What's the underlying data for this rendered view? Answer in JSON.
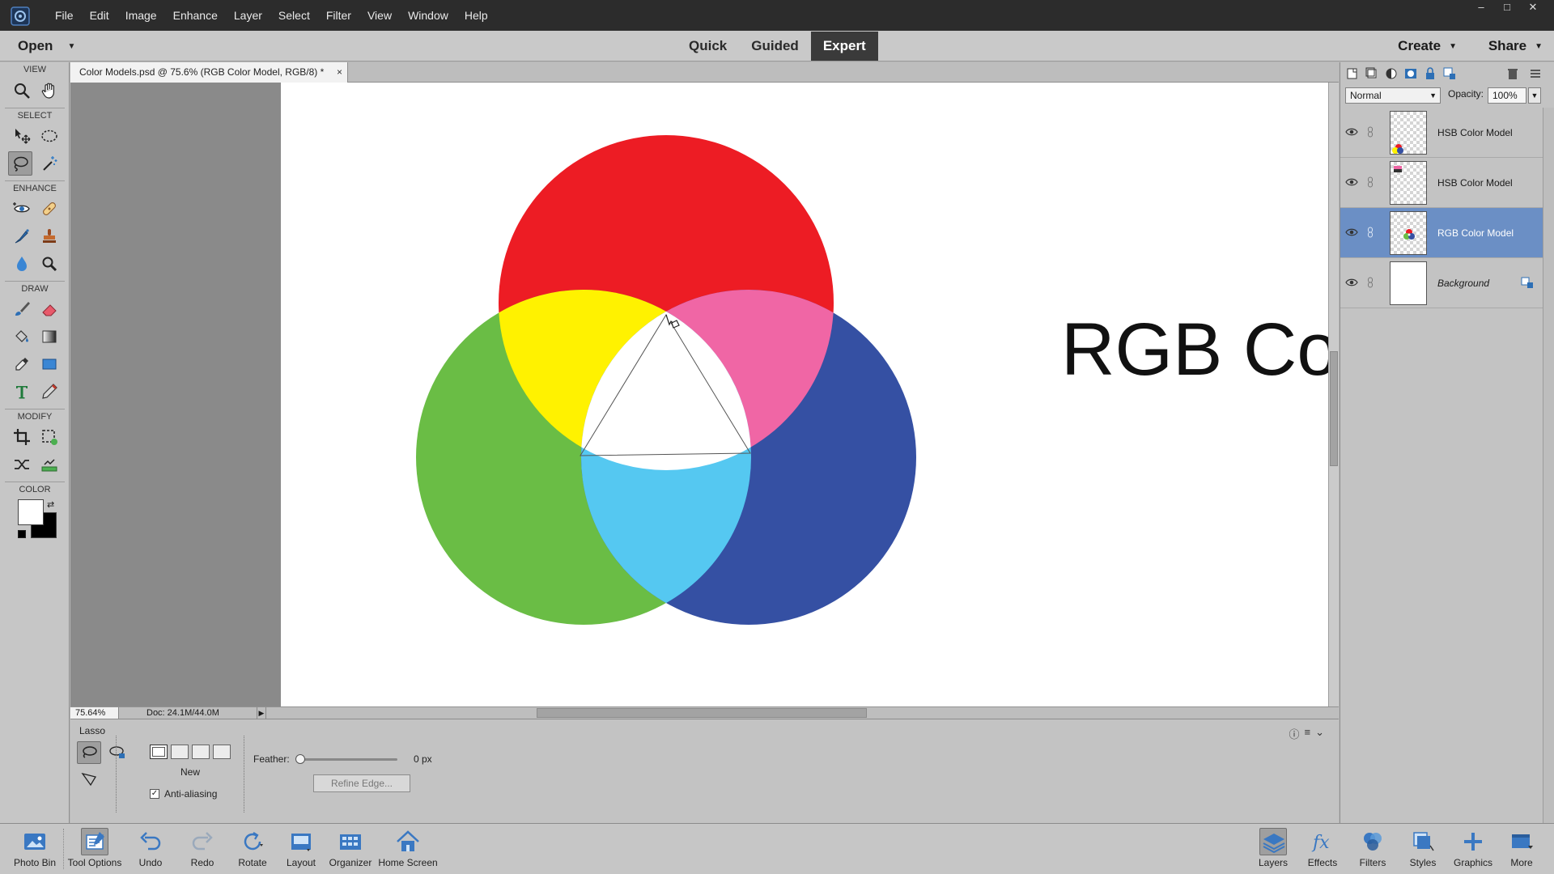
{
  "menu": {
    "items": [
      "File",
      "Edit",
      "Image",
      "Enhance",
      "Layer",
      "Select",
      "Filter",
      "View",
      "Window",
      "Help"
    ]
  },
  "window_controls": {
    "minimize": "–",
    "restore": "□",
    "close": "✕"
  },
  "modebar": {
    "open_label": "Open",
    "modes": [
      "Quick",
      "Guided",
      "Expert"
    ],
    "active_mode": "Expert",
    "create_label": "Create",
    "share_label": "Share"
  },
  "toolbox": {
    "sections": {
      "view": "VIEW",
      "select": "SELECT",
      "enhance": "ENHANCE",
      "draw": "DRAW",
      "modify": "MODIFY",
      "color": "COLOR"
    },
    "active_tool": "lasso",
    "foreground_color": "#ffffff",
    "background_color": "#000000"
  },
  "document": {
    "tab_title": "Color Models.psd @ 75.6% (RGB Color Model, RGB/8) *",
    "close_glyph": "×",
    "heading": "RGB Co",
    "colors": {
      "red": "#ed1c24",
      "green": "#6abd45",
      "blue": "#3550a3",
      "yellow": "#fff200",
      "magenta": "#f066a5",
      "cyan": "#55c8f1",
      "white": "#ffffff"
    }
  },
  "status": {
    "zoom": "75.64%",
    "doc_size": "Doc: 24.1M/44.0M",
    "arrow": "▶"
  },
  "tool_options": {
    "tool_name": "Lasso",
    "selection_mode_label": "New",
    "feather_label": "Feather:",
    "feather_value": 0,
    "feather_unit": "0 px",
    "anti_alias_label": "Anti-aliasing",
    "anti_alias_checked": true,
    "refine_edge_label": "Refine Edge..."
  },
  "layers": {
    "blend_mode": "Normal",
    "opacity_label": "Opacity:",
    "opacity_value": "100%",
    "items": [
      {
        "name": "HSB Color Model",
        "selected": false,
        "visible": true
      },
      {
        "name": "HSB Color Model",
        "selected": false,
        "visible": true
      },
      {
        "name": "RGB Color Model",
        "selected": true,
        "visible": true
      },
      {
        "name": "Background",
        "selected": false,
        "visible": true,
        "locked": true
      }
    ]
  },
  "taskbar": {
    "left": [
      {
        "label": "Photo Bin",
        "icon": "photo-bin-icon"
      },
      {
        "label": "Tool Options",
        "icon": "tool-options-icon"
      },
      {
        "label": "Undo",
        "icon": "undo-icon"
      },
      {
        "label": "Redo",
        "icon": "redo-icon"
      },
      {
        "label": "Rotate",
        "icon": "rotate-icon"
      },
      {
        "label": "Layout",
        "icon": "layout-icon"
      },
      {
        "label": "Organizer",
        "icon": "organizer-icon"
      },
      {
        "label": "Home Screen",
        "icon": "home-icon"
      }
    ],
    "right": [
      {
        "label": "Layers",
        "icon": "layers-icon"
      },
      {
        "label": "Effects",
        "icon": "fx-icon"
      },
      {
        "label": "Filters",
        "icon": "filters-icon"
      },
      {
        "label": "Styles",
        "icon": "styles-icon"
      },
      {
        "label": "Graphics",
        "icon": "plus-icon"
      },
      {
        "label": "More",
        "icon": "more-icon"
      }
    ]
  }
}
